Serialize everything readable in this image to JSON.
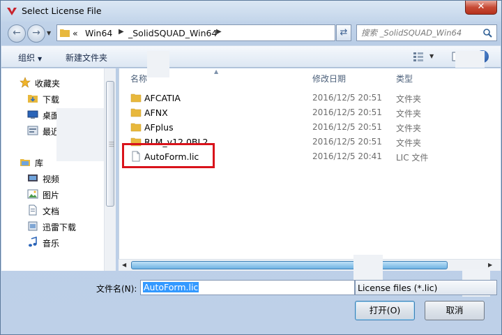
{
  "window": {
    "title": "Select License File",
    "close_label": "✕"
  },
  "address": {
    "overflow": "«",
    "crumbs": [
      "Win64",
      "_SolidSQUAD_Win64"
    ]
  },
  "search": {
    "placeholder": "搜索 _SolidSQUAD_Win64"
  },
  "toolbar": {
    "organize_label": "组织",
    "new_folder_label": "新建文件夹"
  },
  "nav": {
    "favorites": "收藏夹",
    "downloads": "下载",
    "desktop": "桌面",
    "recent": "最近",
    "library": "库",
    "videos": "视频",
    "pictures": "图片",
    "documents": "文档",
    "xunlei": "迅雷下载",
    "music": "音乐"
  },
  "list": {
    "col_name": "名称",
    "col_date": "修改日期",
    "col_type": "类型",
    "rows": [
      {
        "name": "AFCATIA",
        "date": "2016/12/5 20:51",
        "type": "文件夹"
      },
      {
        "name": "AFNX",
        "date": "2016/12/5 20:51",
        "type": "文件夹"
      },
      {
        "name": "AFplus",
        "date": "2016/12/5 20:51",
        "type": "文件夹"
      },
      {
        "name": "RLM_v12.0BL2",
        "date": "2016/12/5 20:51",
        "type": "文件夹"
      },
      {
        "name": "AutoForm.lic",
        "date": "2016/12/5 20:41",
        "type": "LIC 文件"
      }
    ]
  },
  "bottom": {
    "filename_label": "文件名(N):",
    "filename_value": "AutoForm.lic",
    "filter_value": "License files (*.lic)",
    "open_label": "打开(O)",
    "cancel_label": "取消"
  },
  "colors": {
    "highlight": "#d9131b",
    "folder": "#e8b83c",
    "selection": "#3399ff"
  }
}
